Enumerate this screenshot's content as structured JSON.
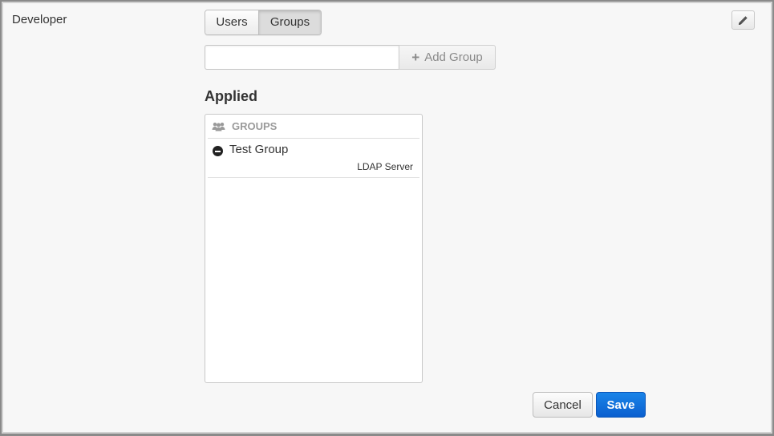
{
  "role": {
    "name": "Developer"
  },
  "toolbar": {
    "edit_icon": "pencil-icon"
  },
  "tabs": [
    {
      "label": "Users",
      "active": false
    },
    {
      "label": "Groups",
      "active": true
    }
  ],
  "add_group": {
    "value": "",
    "placeholder": "",
    "button_label": "Add Group"
  },
  "applied": {
    "heading": "Applied",
    "section_label": "GROUPS",
    "section_icon": "users-icon",
    "items": [
      {
        "name": "Test Group",
        "source": "LDAP Server"
      }
    ]
  },
  "actions": {
    "cancel_label": "Cancel",
    "save_label": "Save"
  },
  "colors": {
    "primary": "#0a6ed8",
    "muted": "#9a9a9a"
  }
}
